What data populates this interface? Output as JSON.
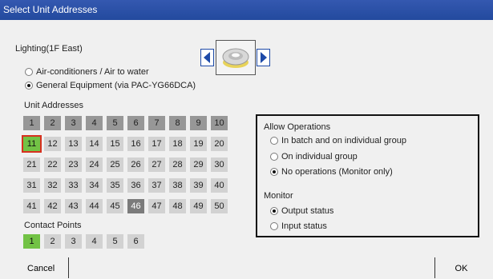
{
  "window": {
    "title": "Select Unit Addresses"
  },
  "group": {
    "name": "Lighting(1F East)",
    "icon": "light-fixture-icon"
  },
  "equipment_type": {
    "options": [
      {
        "label": "Air-conditioners / Air to water",
        "checked": false
      },
      {
        "label": "General Equipment (via PAC-YG66DCA)",
        "checked": true
      }
    ]
  },
  "unit_addresses": {
    "heading": "Unit Addresses",
    "rows": [
      [
        "1",
        "2",
        "3",
        "4",
        "5",
        "6",
        "7",
        "8",
        "9",
        "10"
      ],
      [
        "11",
        "12",
        "13",
        "14",
        "15",
        "16",
        "17",
        "18",
        "19",
        "20"
      ],
      [
        "21",
        "22",
        "23",
        "24",
        "25",
        "26",
        "27",
        "28",
        "29",
        "30"
      ],
      [
        "31",
        "32",
        "33",
        "34",
        "35",
        "36",
        "37",
        "38",
        "39",
        "40"
      ],
      [
        "41",
        "42",
        "43",
        "44",
        "45",
        "46",
        "47",
        "48",
        "49",
        "50"
      ]
    ],
    "focused": "11",
    "current_group": "11",
    "selected_other": "46",
    "darker_row": 1
  },
  "contact_points": {
    "heading": "Contact Points",
    "items": [
      "1",
      "2",
      "3",
      "4",
      "5",
      "6"
    ],
    "selected": "1"
  },
  "allow_operations": {
    "heading": "Allow Operations",
    "options": [
      {
        "label": "In batch and on individual group",
        "checked": false
      },
      {
        "label": "On individual group",
        "checked": false
      },
      {
        "label": "No operations (Monitor only)",
        "checked": true
      }
    ]
  },
  "monitor": {
    "heading": "Monitor",
    "options": [
      {
        "label": "Output status",
        "checked": true
      },
      {
        "label": "Input status",
        "checked": false
      }
    ]
  },
  "buttons": {
    "cancel": "Cancel",
    "ok": "OK"
  },
  "colors": {
    "title_bar": "#2d54a8",
    "assigned_green": "#72c245",
    "focus_outline": "#d7301f",
    "other_group": "#7b7b7b",
    "arrow_blue": "#1d4aa8"
  }
}
